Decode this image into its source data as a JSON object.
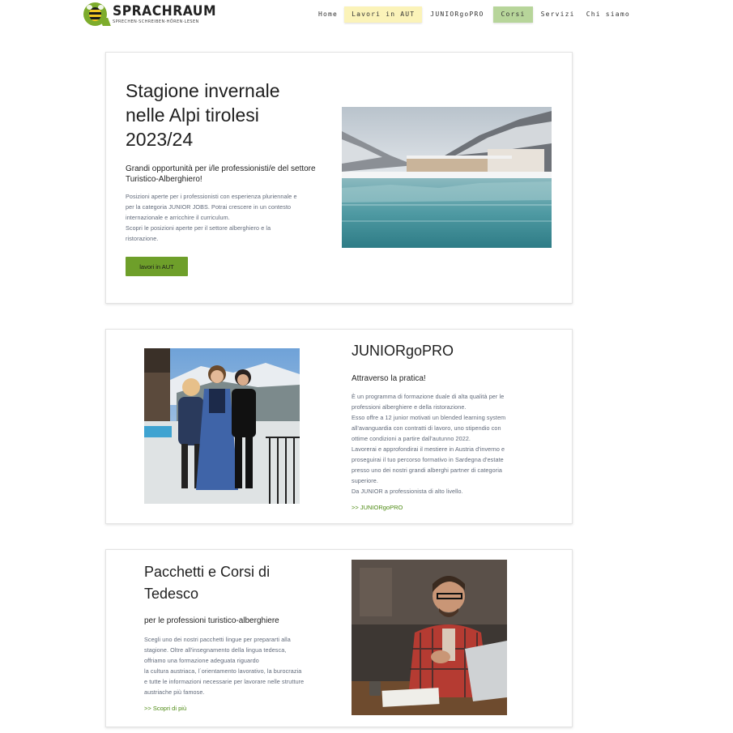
{
  "header": {
    "logo_title": "SPRACHRAUM",
    "logo_subtitle": "SPRECHEN·SCHREIBEN·HÖREN·LESEN",
    "nav": [
      {
        "label": "Home"
      },
      {
        "label": "Lavori in AUT"
      },
      {
        "label": "JUNIORgoPRO"
      },
      {
        "label": "Corsi"
      },
      {
        "label": "Servizi"
      },
      {
        "label": "Chi siamo"
      }
    ]
  },
  "card1": {
    "title_lines": [
      "Stagione invernale",
      "nelle Alpi tirolesi",
      "2023/24"
    ],
    "subtitle_lines": [
      "Grandi opportunità per i/le professionisti/e del settore",
      "Turistico-Alberghiero!"
    ],
    "body_lines": [
      "Posizioni aperte per i professionisti con esperienza pluriennale e",
      "per la categoria JUNIOR JOBS. Potrai crescere in un contesto",
      "internazionale e arricchire il curriculum.",
      "Scopri le posizioni aperte per il settore alberghiero e la",
      "ristorazione."
    ],
    "button_label": "lavori in AUT"
  },
  "card2": {
    "title": "JUNIORgoPRO",
    "subtitle": "Attraverso la pratica!",
    "body_lines": [
      "È un programma di formazione duale di alta qualità per le",
      "professioni alberghiere e della ristorazione.",
      "Esso offre a 12 junior motivati un blended learning system",
      "all'avanguardia con contratti di lavoro, uno stipendio con",
      "ottime condizioni a partire dall'autunno 2022.",
      "Lavorerai e approfondirai il mestiere in Austria d'inverno e",
      "proseguirai il tuo percorso formativo in Sardegna d'estate",
      "presso uno dei nostri grandi alberghi partner di categoria",
      "superiore.",
      "Da JUNIOR a professionista di alto livello."
    ],
    "link": ">> JUNIORgoPRO"
  },
  "card3": {
    "title_lines": [
      "Pacchetti e Corsi di",
      "Tedesco"
    ],
    "subtitle": "per le professioni turistico-alberghiere",
    "body_lines": [
      "Scegli uno dei nostri pacchetti lingue per prepararti alla",
      "stagione. Oltre all'insegnamento della lingua tedesca,",
      "offriamo una formazione adeguata riguardo",
      "la cultura austriaca, l´orientamento lavorativo, la burocrazia",
      "e tutte le informazioni necessarie per lavorare nelle strutture",
      "austriache più famose."
    ],
    "link": ">> Scopri di più"
  }
}
